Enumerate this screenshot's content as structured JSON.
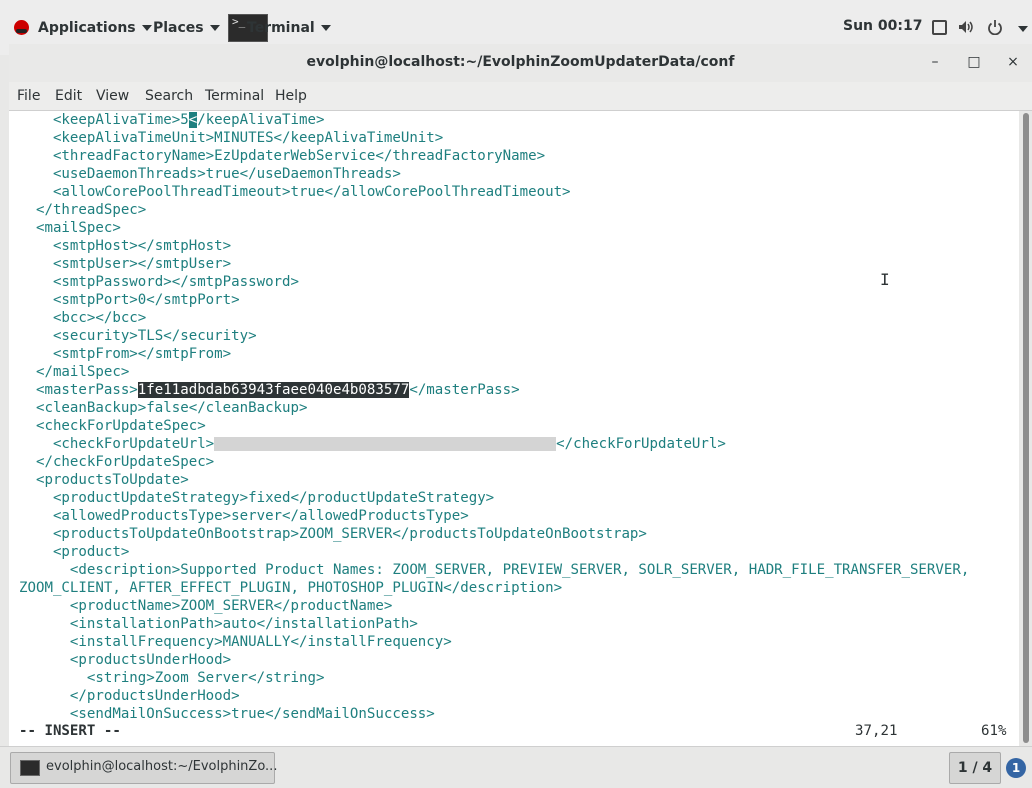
{
  "top_panel": {
    "applications_label": "Applications",
    "places_label": "Places",
    "terminal_label": "Terminal",
    "clock": "Sun 00:17",
    "terminal_icon_glyph": ">_"
  },
  "window": {
    "title": "evolphin@localhost:~/EvolphinZoomUpdaterData/conf",
    "minimize": "–",
    "maximize": "□",
    "close": "×"
  },
  "menu": {
    "file": "File",
    "edit": "Edit",
    "view": "View",
    "search": "Search",
    "terminal": "Terminal",
    "help": "Help"
  },
  "editor": {
    "lines": {
      "l0_pre": "    <keepAlivaTime>5",
      "l0_cursor": "<",
      "l0_post": "/keepAlivaTime>",
      "l1": "    <keepAlivaTimeUnit>MINUTES</keepAlivaTimeUnit>",
      "l2": "    <threadFactoryName>EzUpdaterWebService</threadFactoryName>",
      "l3": "    <useDaemonThreads>true</useDaemonThreads>",
      "l4": "    <allowCorePoolThreadTimeout>true</allowCorePoolThreadTimeout>",
      "l5": "  </threadSpec>",
      "l6": "  <mailSpec>",
      "l7": "    <smtpHost></smtpHost>",
      "l8": "    <smtpUser></smtpUser>",
      "l9": "    <smtpPassword></smtpPassword>",
      "l10": "    <smtpPort>0</smtpPort>",
      "l11": "    <bcc></bcc>",
      "l12": "    <security>TLS</security>",
      "l13": "    <smtpFrom></smtpFrom>",
      "l14": "  </mailSpec>",
      "l15_pre": "  <masterPass>",
      "l15_sel": "1fe11adbdab63943faee040e4b083577",
      "l15_post": "</masterPass>",
      "l16": "  <cleanBackup>false</cleanBackup>",
      "l17": "  <checkForUpdateSpec>",
      "l18_pre": "    <checkForUpdateUrl>",
      "l18_post": "</checkForUpdateUrl>",
      "l19": "  </checkForUpdateSpec>",
      "l20": "  <productsToUpdate>",
      "l21": "    <productUpdateStrategy>fixed</productUpdateStrategy>",
      "l22": "    <allowedProductsType>server</allowedProductsType>",
      "l23": "    <productsToUpdateOnBootstrap>ZOOM_SERVER</productsToUpdateOnBootstrap>",
      "l24": "    <product>",
      "l25": "      <description>Supported Product Names: ZOOM_SERVER, PREVIEW_SERVER, SOLR_SERVER, HADR_FILE_TRANSFER_SERVER,",
      "l26": "ZOOM_CLIENT, AFTER_EFFECT_PLUGIN, PHOTOSHOP_PLUGIN</description>",
      "l27": "      <productName>ZOOM_SERVER</productName>",
      "l28": "      <installationPath>auto</installationPath>",
      "l29": "      <installFrequency>MANUALLY</installFrequency>",
      "l30": "      <productsUnderHood>",
      "l31": "        <string>Zoom Server</string>",
      "l32": "      </productsUnderHood>",
      "l33": "      <sendMailOnSuccess>true</sendMailOnSuccess>"
    },
    "status_mode": "-- INSERT --",
    "status_position": "37,21",
    "status_percent": "61%"
  },
  "taskbar": {
    "task_label": "evolphin@localhost:~/EvolphinZo...",
    "workspace": "1 / 4",
    "notification_count": "1"
  },
  "colors": {
    "tag": "#1e7f7f",
    "text": "#2e3436",
    "selection_bg": "#2e3436"
  }
}
